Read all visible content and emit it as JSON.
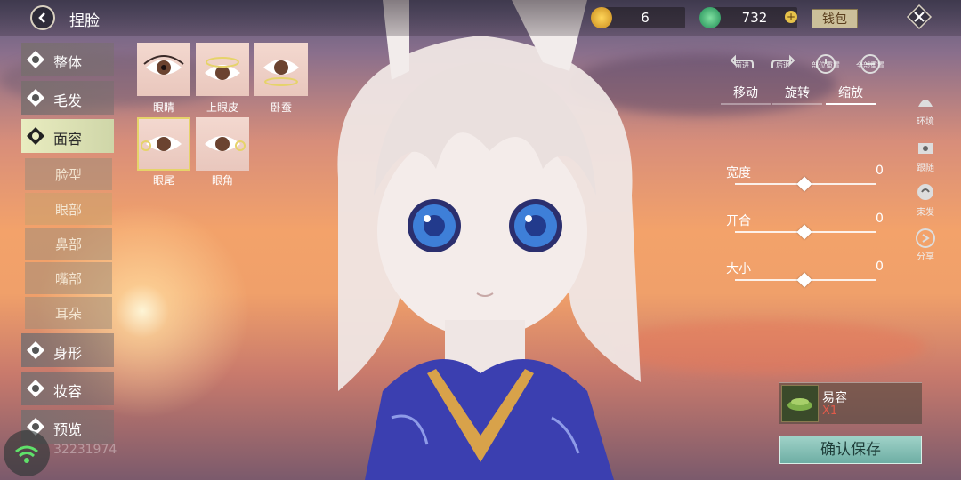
{
  "header": {
    "title": "捏脸",
    "wallet_label": "钱包"
  },
  "currency": [
    {
      "icon": "gold-coin-icon",
      "value": "6"
    },
    {
      "icon": "jade-coin-icon",
      "value": "732"
    }
  ],
  "categories": [
    {
      "icon": "body-icon",
      "label": "整体"
    },
    {
      "icon": "hair-icon",
      "label": "毛发"
    },
    {
      "icon": "face-icon",
      "label": "面容"
    },
    {
      "icon": "figure-icon",
      "label": "身形"
    },
    {
      "icon": "makeup-icon",
      "label": "妆容"
    },
    {
      "icon": "preview-icon",
      "label": "预览"
    }
  ],
  "subcategories": [
    "脸型",
    "眼部",
    "鼻部",
    "嘴部",
    "耳朵"
  ],
  "eye_parts": [
    "眼睛",
    "上眼皮",
    "卧蚕",
    "眼尾",
    "眼角"
  ],
  "tools": [
    "前进",
    "后退",
    "部位重置",
    "全部重置"
  ],
  "tabs": [
    "移动",
    "旋转",
    "缩放"
  ],
  "sliders": [
    {
      "label": "宽度",
      "value": "0"
    },
    {
      "label": "开合",
      "value": "0"
    },
    {
      "label": "大小",
      "value": "0"
    }
  ],
  "side_tools": [
    {
      "icon": "environment-icon",
      "label": "环境"
    },
    {
      "icon": "camera-follow-icon",
      "label": "跟随"
    },
    {
      "icon": "tie-hair-icon",
      "label": "束发"
    },
    {
      "icon": "share-icon",
      "label": "分享"
    }
  ],
  "item": {
    "name": "易容",
    "count": "X1"
  },
  "save_label": "确认保存",
  "watermark": "32231974",
  "colors": {
    "accent": "#e9ecc0",
    "save": "#8cc6bc",
    "count": "#e05a4a"
  }
}
